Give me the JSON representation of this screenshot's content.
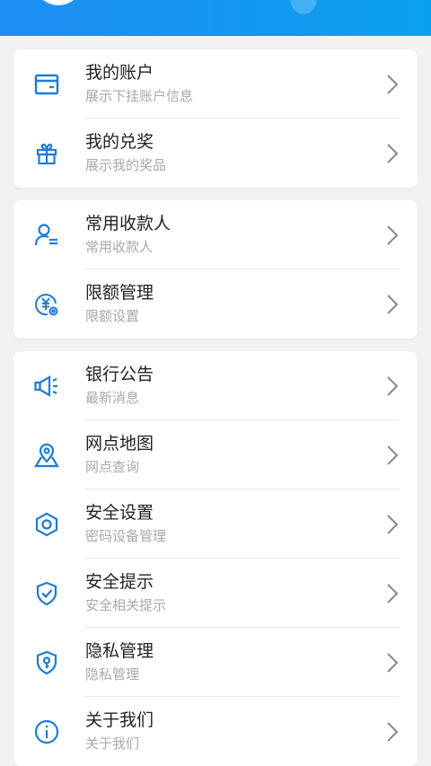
{
  "colors": {
    "accent": "#1f7bd8",
    "header": "#1f8ef3",
    "chevron": "#888888"
  },
  "groups": [
    {
      "items": [
        {
          "icon": "card-icon",
          "title": "我的账户",
          "subtitle": "展示下挂账户信息"
        },
        {
          "icon": "gift-icon",
          "title": "我的兑奖",
          "subtitle": "展示我的奖品"
        }
      ]
    },
    {
      "items": [
        {
          "icon": "payee-icon",
          "title": "常用收款人",
          "subtitle": "常用收款人"
        },
        {
          "icon": "limit-icon",
          "title": "限额管理",
          "subtitle": "限额设置"
        }
      ]
    },
    {
      "items": [
        {
          "icon": "megaphone-icon",
          "title": "银行公告",
          "subtitle": "最新消息"
        },
        {
          "icon": "map-pin-icon",
          "title": "网点地图",
          "subtitle": "网点查询"
        },
        {
          "icon": "hexagon-settings-icon",
          "title": "安全设置",
          "subtitle": "密码设备管理"
        },
        {
          "icon": "shield-check-icon",
          "title": "安全提示",
          "subtitle": "安全相关提示"
        },
        {
          "icon": "shield-key-icon",
          "title": "隐私管理",
          "subtitle": "隐私管理"
        },
        {
          "icon": "info-icon",
          "title": "关于我们",
          "subtitle": "关于我们"
        }
      ]
    }
  ]
}
